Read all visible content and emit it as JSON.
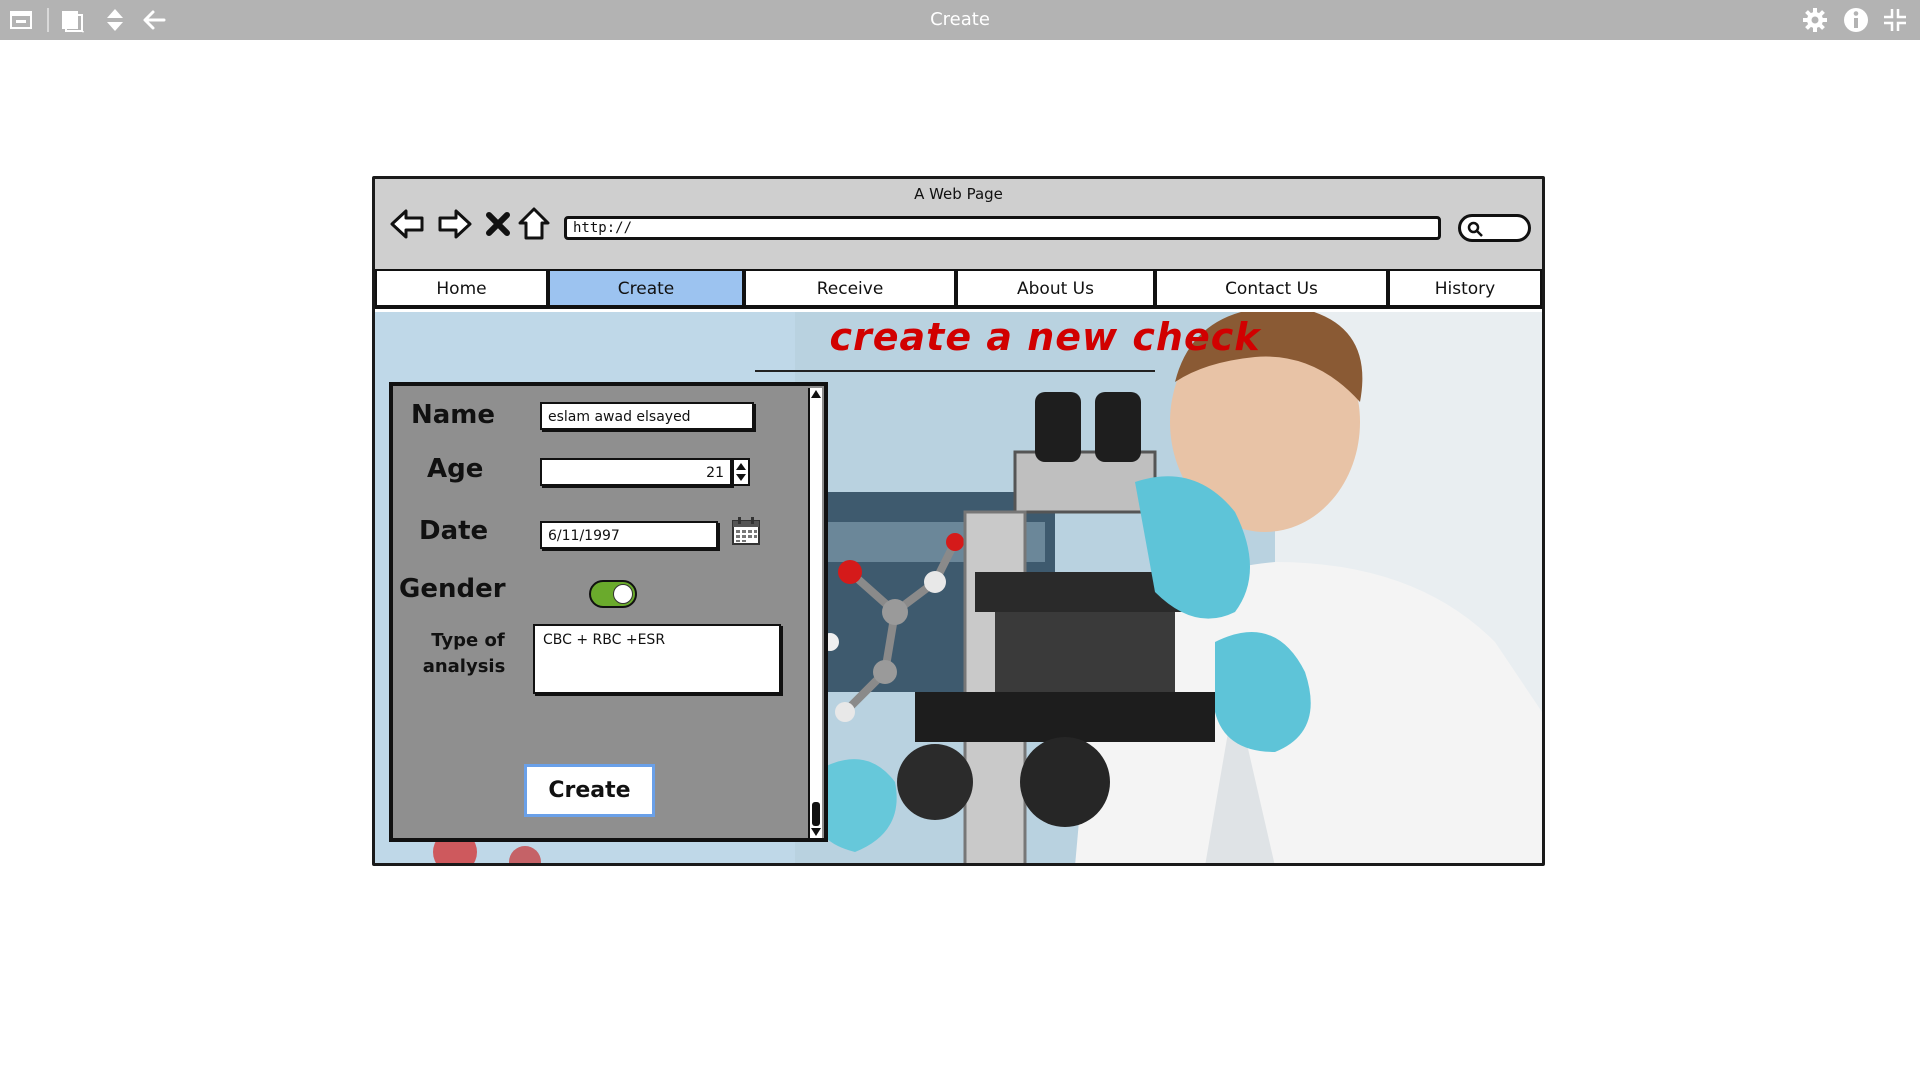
{
  "app": {
    "title": "Create"
  },
  "browser": {
    "title": "A Web Page",
    "url": "http://"
  },
  "nav": {
    "tabs": [
      {
        "label": "Home",
        "active": false
      },
      {
        "label": "Create",
        "active": true
      },
      {
        "label": "Receive",
        "active": false
      },
      {
        "label": "About Us",
        "active": false
      },
      {
        "label": "Contact Us",
        "active": false
      },
      {
        "label": "History",
        "active": false
      }
    ]
  },
  "page": {
    "heading": "create a new check"
  },
  "form": {
    "name_label": "Name",
    "name_value": "eslam awad elsayed",
    "age_label": "Age",
    "age_value": "21",
    "date_label": "Date",
    "date_value": "6/11/1997",
    "gender_label": "Gender",
    "gender_toggle_on": true,
    "analysis_label_line1": "Type of",
    "analysis_label_line2": "analysis",
    "analysis_value": "CBC + RBC +ESR",
    "submit_label": "Create"
  },
  "colors": {
    "toolbar_bg": "#b3b3b3",
    "active_tab": "#9cc3f0",
    "heading": "#d10000",
    "panel_bg": "#8f8f8f",
    "toggle_on": "#6aaa2c",
    "button_border": "#6aa0e8"
  },
  "icons": {
    "app_toolbar_left": [
      "window-icon",
      "layers-icon",
      "sort-icon",
      "back-arrow-icon"
    ],
    "app_toolbar_right": [
      "gear-icon",
      "info-icon",
      "collapse-icon"
    ],
    "browser_nav": [
      "back-icon",
      "forward-icon",
      "close-icon",
      "home-icon"
    ]
  }
}
